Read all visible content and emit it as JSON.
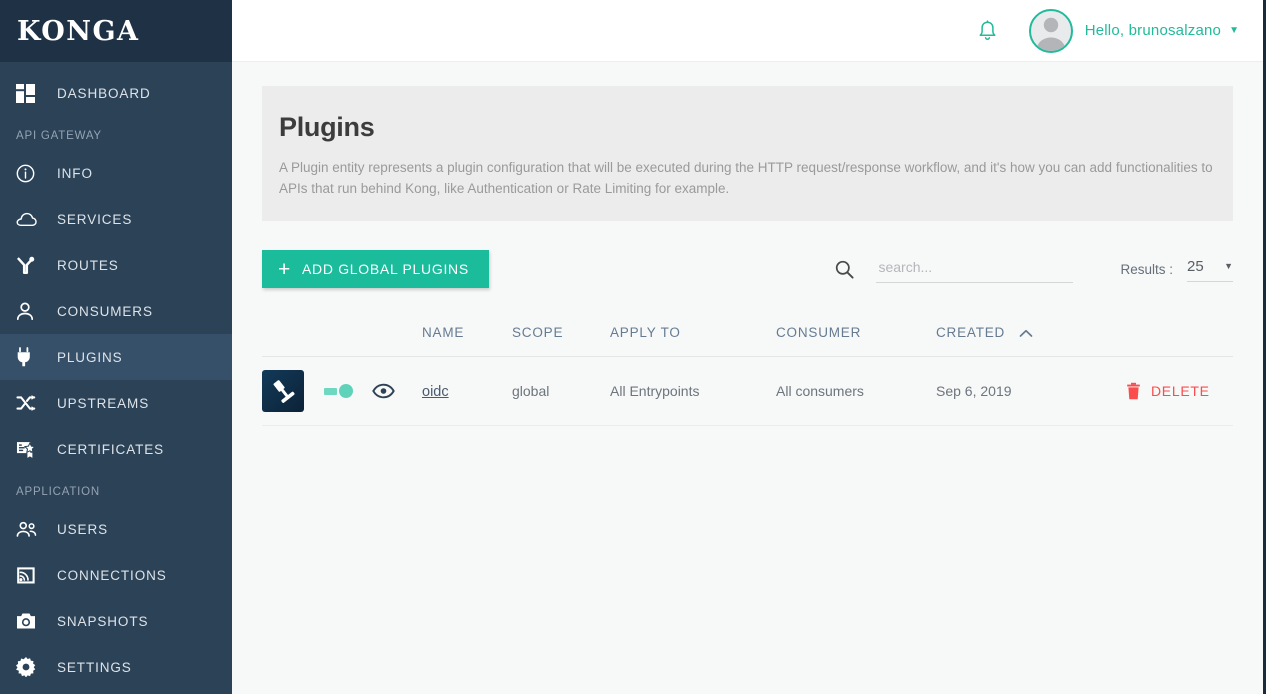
{
  "brand": {
    "logo_text": "KONGA"
  },
  "colors": {
    "accent_teal": "#1abc9c",
    "sidebar_bg": "#2b4257",
    "sidebar_logo_bg": "#1e3145",
    "sidebar_active_bg": "#37506a",
    "danger_red": "#fa4d4d",
    "table_header": "#667b92",
    "panel_bg": "#ececec"
  },
  "topbar": {
    "bell_icon": "bell-icon",
    "avatar_icon": "user-avatar-placeholder",
    "greeting": "Hello, brunosalzano",
    "caret_icon": "caret-down-icon"
  },
  "sidebar": {
    "groups": [
      {
        "label": "",
        "items": [
          {
            "label": "DASHBOARD",
            "icon": "dashboard-grid-icon",
            "active": false
          }
        ]
      },
      {
        "label": "API GATEWAY",
        "items": [
          {
            "label": "INFO",
            "icon": "info-circle-icon",
            "active": false
          },
          {
            "label": "SERVICES",
            "icon": "cloud-icon",
            "active": false
          },
          {
            "label": "ROUTES",
            "icon": "routes-branch-icon",
            "active": false
          },
          {
            "label": "CONSUMERS",
            "icon": "person-icon",
            "active": false
          },
          {
            "label": "PLUGINS",
            "icon": "plug-icon",
            "active": true
          },
          {
            "label": "UPSTREAMS",
            "icon": "shuffle-icon",
            "active": false
          },
          {
            "label": "CERTIFICATES",
            "icon": "certificate-icon",
            "active": false
          }
        ]
      },
      {
        "label": "APPLICATION",
        "items": [
          {
            "label": "USERS",
            "icon": "users-group-icon",
            "active": false
          },
          {
            "label": "CONNECTIONS",
            "icon": "connections-cast-icon",
            "active": false
          },
          {
            "label": "SNAPSHOTS",
            "icon": "camera-icon",
            "active": false
          },
          {
            "label": "SETTINGS",
            "icon": "gear-icon",
            "active": false
          }
        ]
      }
    ]
  },
  "page": {
    "title": "Plugins",
    "description": "A Plugin entity represents a plugin configuration that will be executed during the HTTP request/response workflow, and it's how you can add functionalities to APIs that run behind Kong, like Authentication or Rate Limiting for example."
  },
  "toolbar": {
    "add_button_label": "ADD GLOBAL PLUGINS",
    "add_button_icon": "plus-icon",
    "search_icon": "search-icon",
    "search_value": "",
    "search_placeholder": "search...",
    "results_label": "Results :",
    "results_value": "25",
    "results_caret_icon": "caret-down-icon"
  },
  "table": {
    "columns": [
      {
        "key": "icon",
        "label": ""
      },
      {
        "key": "toggle",
        "label": ""
      },
      {
        "key": "eye",
        "label": ""
      },
      {
        "key": "name",
        "label": "NAME"
      },
      {
        "key": "scope",
        "label": "SCOPE"
      },
      {
        "key": "apply_to",
        "label": "APPLY TO"
      },
      {
        "key": "consumer",
        "label": "CONSUMER"
      },
      {
        "key": "created",
        "label": "CREATED"
      },
      {
        "key": "action",
        "label": ""
      }
    ],
    "sorted_column": "CREATED",
    "sort_direction": "asc",
    "sort_icon": "chevron-up-icon",
    "rows": [
      {
        "plugin_icon": "gavel-plugin-icon",
        "enabled": true,
        "toggle_name": "plugin-enabled-toggle",
        "eye_icon": "eye-icon",
        "name": "oidc",
        "scope": "global",
        "apply_to": "All Entrypoints",
        "consumer": "All consumers",
        "created": "Sep 6, 2019",
        "delete_label": "DELETE",
        "delete_icon": "trash-icon"
      }
    ]
  }
}
